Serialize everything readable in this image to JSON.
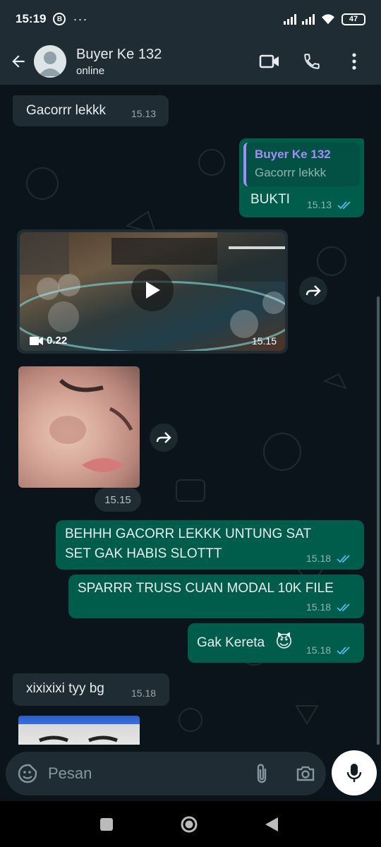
{
  "status_bar": {
    "time": "15:19",
    "b_badge": "B",
    "dots": "···",
    "battery": "47"
  },
  "header": {
    "contact_name": "Buyer Ke 132",
    "contact_status": "online",
    "icons": [
      "back-arrow-icon",
      "avatar",
      "video-call-icon",
      "phone-icon",
      "more-vert-icon"
    ]
  },
  "messages": [
    {
      "id": "m1",
      "direction": "in",
      "text": "Gacorrr lekkk",
      "time": "15.13"
    },
    {
      "id": "m2",
      "direction": "out",
      "quote_name": "Buyer Ke 132",
      "quote_text": "Gacorrr lekkk",
      "text": "BUKTI",
      "time": "15.13",
      "status": "read"
    },
    {
      "id": "m3",
      "direction": "in",
      "type": "video",
      "duration": "0.22",
      "time": "15.15"
    },
    {
      "id": "m4",
      "direction": "in",
      "type": "image",
      "time": "15.15"
    },
    {
      "id": "m5",
      "direction": "out",
      "text_line1": "BEHHH GACORR LEKKK UNTUNG SAT",
      "text_line2": "SET GAK HABIS SLOTTT",
      "time": "15.18",
      "status": "read"
    },
    {
      "id": "m6",
      "direction": "out",
      "text": "SPARRR TRUSS CUAN MODAL 10K FILE",
      "time": "15.18",
      "status": "read"
    },
    {
      "id": "m7",
      "direction": "out",
      "text": "Gak Kereta",
      "emoji": "😈",
      "time": "15.18",
      "status": "read"
    },
    {
      "id": "m8",
      "direction": "in",
      "text": "xixixixi tyy bg",
      "time": "15.18"
    },
    {
      "id": "m9",
      "direction": "in",
      "type": "image"
    }
  ],
  "input": {
    "placeholder": "Pesan"
  },
  "colors": {
    "header_bg": "#1f2c34",
    "chat_bg": "#0b141a",
    "incoming_bubble": "#1f2c34",
    "outgoing_bubble": "#005c4b",
    "read_ticks": "#53bdeb",
    "quote_accent": "#a78bfa"
  }
}
